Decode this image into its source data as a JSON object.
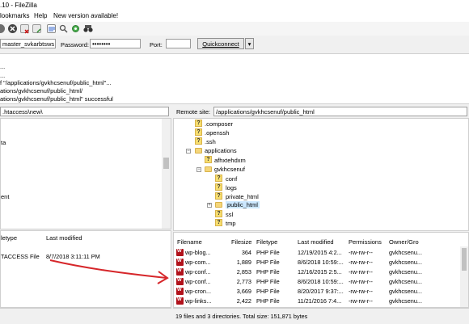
{
  "window": {
    "title": ".10 - FileZilla"
  },
  "menu": {
    "bookmarks": "lookmarks",
    "help": "Help",
    "new_version": "New version available!"
  },
  "toolbar": {
    "icons": [
      "cancel-icon",
      "disconnect-icon",
      "reconnect-icon",
      "filter-icon",
      "search-icon",
      "sync-icon",
      "binoculars-icon"
    ]
  },
  "quickconnect": {
    "username_value": "master_svkarbtsws",
    "password_label": "Password:",
    "password_value": "••••••••",
    "port_label": "Port:",
    "port_value": "",
    "button_label": "Quickconnect",
    "dropdown_symbol": "▾"
  },
  "message_log": [
    "...",
    "...",
    "f \"/applications/gvkhcsenuf/public_html\"...",
    "ations/gvkhcsenuf/public_html/",
    "ations/gvkhcsenuf/public_html\" successful"
  ],
  "local": {
    "path": ".htaccess\\new\\",
    "tree_fragments": [
      "ta",
      "ent"
    ],
    "columns": {
      "filetype": "letype",
      "last_modified": "Last modified"
    },
    "files": [
      {
        "type": "TACCESS File",
        "modified": "8/7/2018 3:11:11 PM"
      }
    ]
  },
  "remote": {
    "site_label": "Remote site:",
    "path": "/applications/gvkhcsenuf/public_html",
    "tree": {
      "composer": ".composer",
      "openssh": ".openssh",
      "ssh": ".ssh",
      "applications": "applications",
      "afhxtehdxm": "afhxtehdxm",
      "gvkhcsenuf": "gvkhcsenuf",
      "conf": "conf",
      "logs": "logs",
      "private_html": "private_html",
      "public_html": "public_html",
      "ssl": "ssl",
      "tmp": "tmp"
    },
    "question_mark": "?",
    "columns": {
      "filename": "Filename",
      "filesize": "Filesize",
      "filetype": "Filetype",
      "last_modified": "Last modified",
      "permissions": "Permissions",
      "owner": "Owner/Gro"
    },
    "files": [
      {
        "name": "wp-blog...",
        "size": "364",
        "type": "PHP File",
        "modified": "12/19/2015 4:2...",
        "perms": "-rw-rw-r--",
        "owner": "gvkhcsenu..."
      },
      {
        "name": "wp-com...",
        "size": "1,889",
        "type": "PHP File",
        "modified": "8/6/2018 10:59:...",
        "perms": "-rw-rw-r--",
        "owner": "gvkhcsenu..."
      },
      {
        "name": "wp-conf...",
        "size": "2,853",
        "type": "PHP File",
        "modified": "12/16/2015 2:5...",
        "perms": "-rw-rw-r--",
        "owner": "gvkhcsenu..."
      },
      {
        "name": "wp-conf...",
        "size": "2,773",
        "type": "PHP File",
        "modified": "8/6/2018 10:59:...",
        "perms": "-rw-rw-r--",
        "owner": "gvkhcsenu..."
      },
      {
        "name": "wp-cron...",
        "size": "3,669",
        "type": "PHP File",
        "modified": "8/20/2017 9:37:...",
        "perms": "-rw-rw-r--",
        "owner": "gvkhcsenu..."
      },
      {
        "name": "wp-links...",
        "size": "2,422",
        "type": "PHP File",
        "modified": "11/21/2016 7:4...",
        "perms": "-rw-rw-r--",
        "owner": "gvkhcsenu..."
      }
    ],
    "status": "19 files and 3 directories. Total size: 151,871 bytes"
  },
  "colors": {
    "annotation_arrow": "#d6262a",
    "selection": "#cce8ff",
    "folder": "#f5d67a",
    "php_icon": "#b1121b"
  }
}
